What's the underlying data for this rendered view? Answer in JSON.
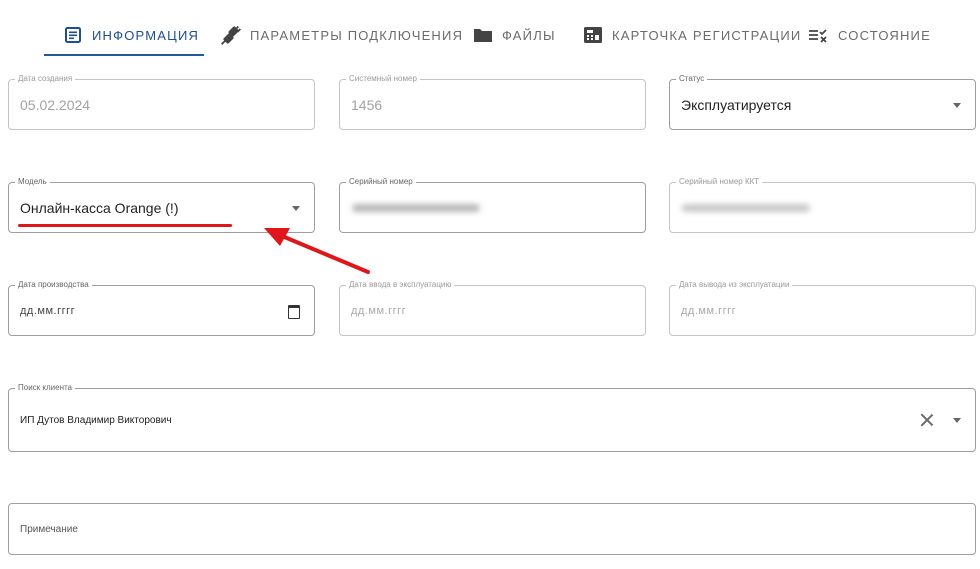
{
  "tabs": [
    {
      "label": "Информация",
      "icon": "document-icon",
      "active": true
    },
    {
      "label": "Параметры подключения",
      "icon": "plug-icon",
      "active": false
    },
    {
      "label": "Файлы",
      "icon": "folder-icon",
      "active": false
    },
    {
      "label": "Карточка регистрации",
      "icon": "cash-register-icon",
      "active": false
    },
    {
      "label": "Состояние",
      "icon": "checklist-icon",
      "active": false
    }
  ],
  "form": {
    "created_date": {
      "label": "Дата создания",
      "value": "05.02.2024"
    },
    "system_number": {
      "label": "Системный номер",
      "value": "1456"
    },
    "status": {
      "label": "Статус",
      "value": "Эксплуатируется"
    },
    "model": {
      "label": "Модель",
      "value": "Онлайн-касса Orange (!)"
    },
    "serial_number": {
      "label": "Серийный номер"
    },
    "kkt_serial_number": {
      "label": "Серийный номер ККТ"
    },
    "production_date": {
      "label": "Дата производства",
      "placeholder": "дд.мм.гггг"
    },
    "commissioning_date": {
      "label": "Дата ввода в эксплуатацию",
      "placeholder": "дд.мм.гггг"
    },
    "decommissioning_date": {
      "label": "Дата вывода из эксплуатации",
      "placeholder": "дд.мм.гггг"
    },
    "client_search": {
      "label": "Поиск клиента",
      "value": "ИП Дутов Владимир Викторович"
    },
    "note": {
      "placeholder": "Примечание"
    }
  },
  "colors": {
    "accent": "#1e4f8c",
    "annotation": "#e0161b"
  }
}
